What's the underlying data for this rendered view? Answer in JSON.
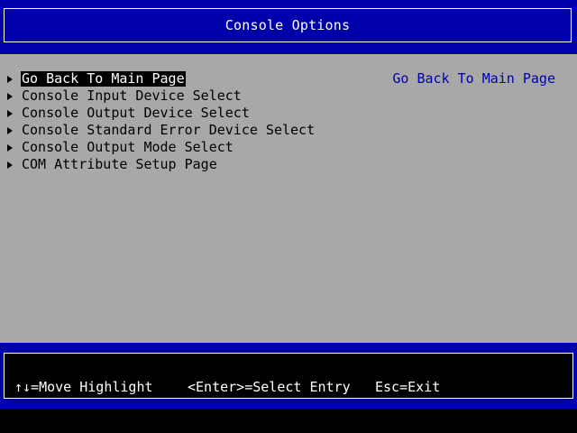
{
  "header": {
    "title": "Console Options"
  },
  "menu": {
    "items": [
      {
        "label": "Go Back To Main Page",
        "selected": true
      },
      {
        "label": "Console Input Device Select",
        "selected": false
      },
      {
        "label": "Console Output Device Select",
        "selected": false
      },
      {
        "label": "Console Standard Error Device Select",
        "selected": false
      },
      {
        "label": "Console Output Mode Select",
        "selected": false
      },
      {
        "label": "COM Attribute Setup Page",
        "selected": false
      }
    ]
  },
  "help": {
    "text": "Go Back To Main Page"
  },
  "footer": {
    "move_highlight": "↑↓=Move Highlight",
    "select_entry": "<Enter>=Select Entry",
    "exit": "Esc=Exit"
  },
  "colors": {
    "header_bg": "#0000aa",
    "body_bg": "#a8a8a8",
    "help_text": "#0000aa",
    "highlight_bg": "#000000",
    "highlight_fg": "#ffffff"
  },
  "icons": {
    "menu_item_marker": "right-triangle-icon"
  }
}
